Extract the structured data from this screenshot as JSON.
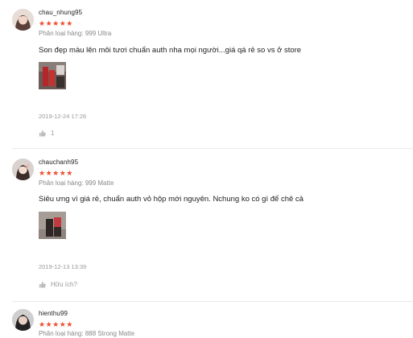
{
  "colors": {
    "star": "#ee4d2d",
    "muted": "#999999",
    "variant": "#888888"
  },
  "reviews": [
    {
      "username": "chau_nhung95",
      "stars": "★★★★★",
      "variant": "Phân loại hàng: 999 Ultra",
      "comment": "Son đẹp màu lên môi tươi chuẩn auth nha mọi người...giá qá rẻ so vs ở store",
      "timestamp": "2019-12-24 17:26",
      "like_label": "1",
      "avatar_icon": "user-avatar-icon",
      "photo_icon": "lipstick-photo-thumbnail"
    },
    {
      "username": "chauchanh95",
      "stars": "★★★★★",
      "variant": "Phân loại hàng: 999 Matte",
      "comment": "Siêu ưng vì giá rẻ, chuẩn auth vỏ hộp mới nguyên. Nchung ko có gì để chê cả",
      "timestamp": "2019-12-13 13:39",
      "like_label": "Hữu ích?",
      "avatar_icon": "user-avatar-icon",
      "photo_icon": "lipstick-photo-thumbnail"
    },
    {
      "username": "hienthu99",
      "stars": "★★★★★",
      "variant": "Phân loại hàng: 888 Strong Matte",
      "avatar_icon": "user-avatar-icon"
    }
  ]
}
